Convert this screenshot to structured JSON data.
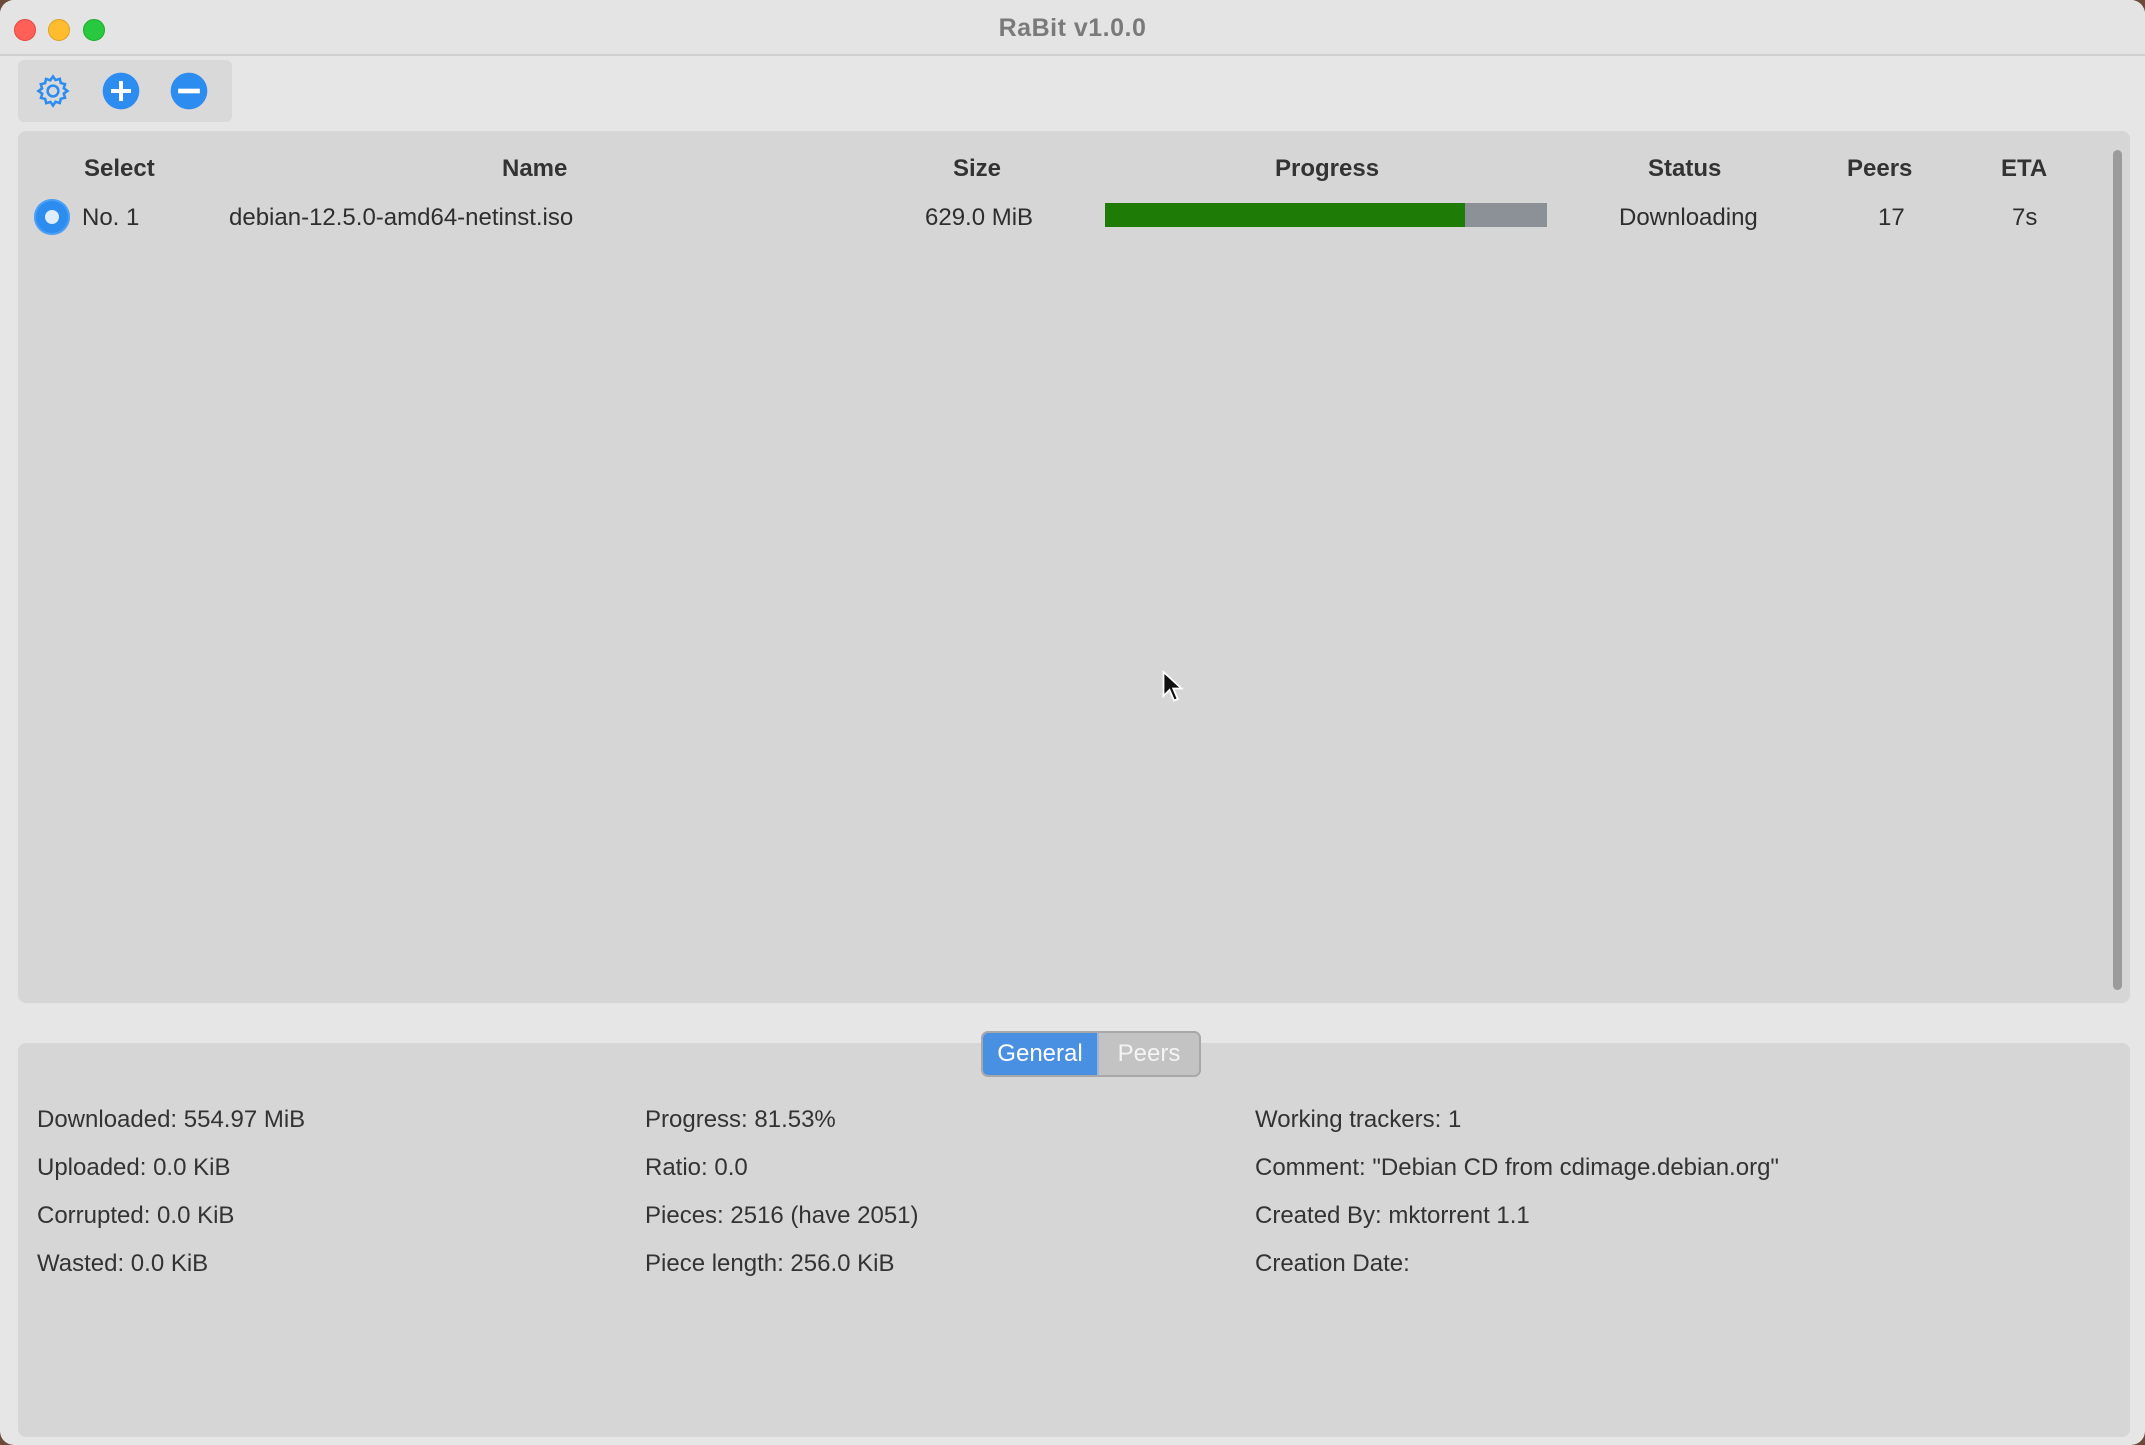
{
  "window": {
    "title": "RaBit v1.0.0"
  },
  "toolbar": {
    "settings_icon": "gear-icon",
    "add_icon": "plus-circle-icon",
    "remove_icon": "minus-circle-icon",
    "accent_color": "#2d8cf0"
  },
  "table": {
    "headers": [
      "Select",
      "Name",
      "Size",
      "Progress",
      "Status",
      "Peers",
      "ETA"
    ],
    "rows": [
      {
        "select": "No. 1",
        "name": "debian-12.5.0-amd64-netinst.iso",
        "size": "629.0 MiB",
        "progress": 0.8153,
        "status": "Downloading",
        "peers": "17",
        "eta": "7s"
      }
    ]
  },
  "tabs": {
    "general": "General",
    "peers": "Peers",
    "active": "General"
  },
  "details": {
    "col1": [
      "Downloaded: 554.97 MiB",
      "Uploaded: 0.0 KiB",
      "Corrupted: 0.0 KiB",
      "Wasted: 0.0 KiB"
    ],
    "col2": [
      "Progress: 81.53%",
      "Ratio: 0.0",
      "Pieces: 2516 (have 2051)",
      "Piece length: 256.0 KiB"
    ],
    "col3": [
      "Working trackers: 1",
      "Comment: \"Debian CD from cdimage.debian.org\"",
      "Created By: mktorrent 1.1",
      "Creation Date:"
    ]
  },
  "colors": {
    "progress_fill": "#1e7b06",
    "progress_track": "#8c9198",
    "tab_active": "#4a90e2"
  }
}
